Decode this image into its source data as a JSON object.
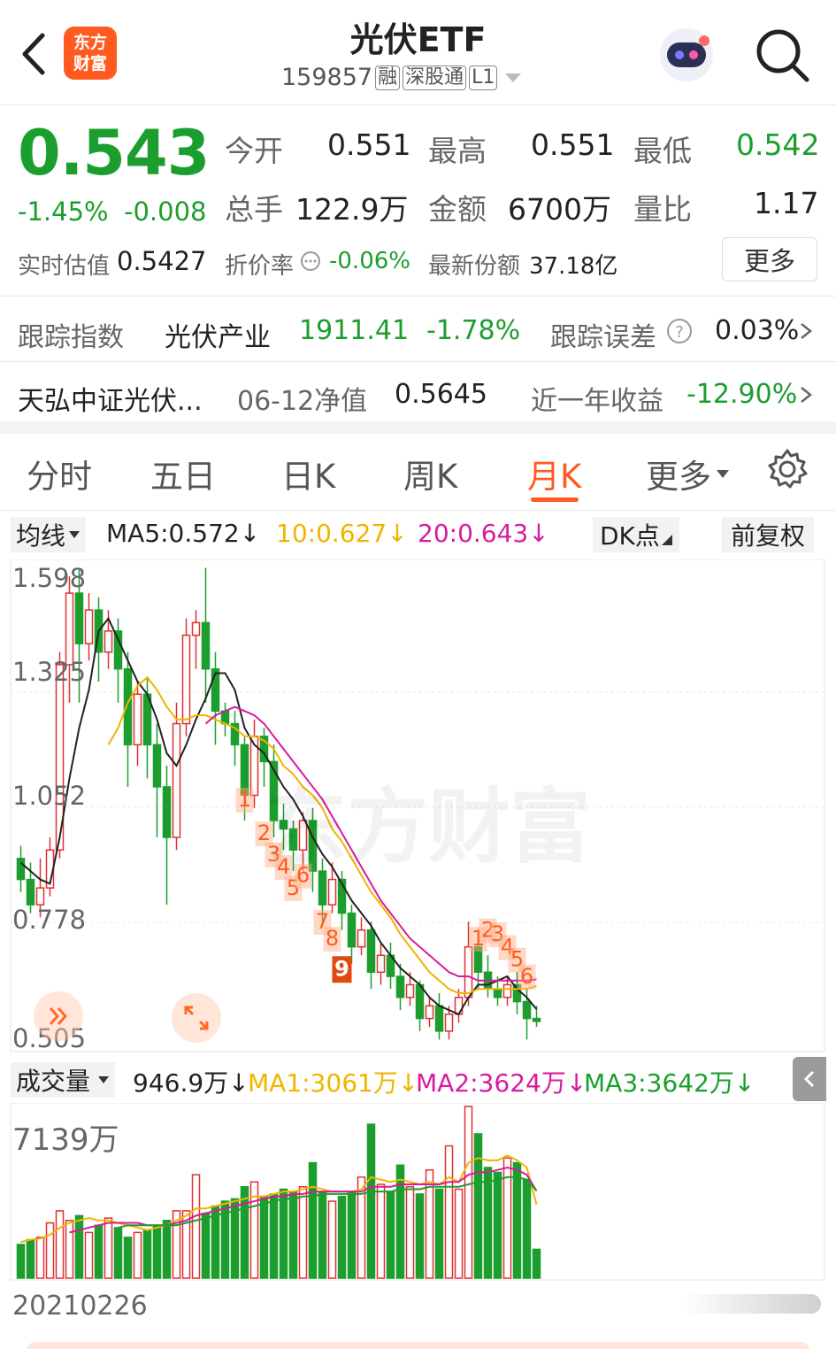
{
  "header": {
    "logo_top": "东方",
    "logo_bottom": "财富",
    "title": "光伏ETF",
    "code": "159857",
    "tags": [
      "融",
      "深股通",
      "L1"
    ]
  },
  "quote": {
    "price": "0.543",
    "change_pct": "-1.45%",
    "change": "-0.008",
    "open_label": "今开",
    "open": "0.551",
    "high_label": "最高",
    "high": "0.551",
    "low_label": "最低",
    "low": "0.542",
    "volume_label": "总手",
    "volume": "122.9万",
    "amount_label": "金额",
    "amount": "6700万",
    "ratio_label": "量比",
    "ratio": "1.17",
    "iopv_label": "实时估值",
    "iopv": "0.5427",
    "discount_label": "折价率",
    "discount": "-0.06%",
    "shares_label": "最新份额",
    "shares": "37.18亿",
    "more_label": "更多"
  },
  "tracking": {
    "index_label": "跟踪指数",
    "index_name": "光伏产业",
    "index_value": "1911.41",
    "index_change": "-1.78%",
    "error_label": "跟踪误差",
    "error_value": "0.03%"
  },
  "fund": {
    "name": "天弘中证光伏...",
    "nav_label": "06-12净值",
    "nav": "0.5645",
    "return_label": "近一年收益",
    "return_value": "-12.90%"
  },
  "tabs": [
    {
      "label": "分时",
      "active": false
    },
    {
      "label": "五日",
      "active": false
    },
    {
      "label": "日K",
      "active": false
    },
    {
      "label": "周K",
      "active": false
    },
    {
      "label": "月K",
      "active": true
    },
    {
      "label": "更多",
      "active": false
    }
  ],
  "ma_bar": {
    "selector": "均线",
    "ma5": "MA5:0.572",
    "ma10": "10:0.627",
    "ma20": "20:0.643",
    "dk_label": "DK点",
    "adjust_label": "前复权"
  },
  "price_axis": [
    "1.598",
    "1.325",
    "1.052",
    "0.778",
    "0.505"
  ],
  "watermark": "东方财富",
  "vol_bar": {
    "selector": "成交量",
    "vol": "946.9万",
    "ma1": "MA1:3061万",
    "ma2": "MA2:3624万",
    "ma3": "MA3:3642万"
  },
  "vol_axis_max": "7139万",
  "start_date": "20210226",
  "colors": {
    "up": "#e03030",
    "down": "#1c9e2e",
    "accent": "#ff5a1f",
    "ma5": "#222222",
    "ma10": "#f0b400",
    "ma20": "#d81b9e"
  },
  "chart_data": {
    "type": "candlestick",
    "ylim": [
      0.505,
      1.598
    ],
    "candles": [
      [
        0.93,
        0.88,
        0.96,
        0.85
      ],
      [
        0.88,
        0.82,
        0.92,
        0.8
      ],
      [
        0.82,
        0.86,
        0.93,
        0.79
      ],
      [
        0.86,
        0.95,
        0.98,
        0.84
      ],
      [
        0.95,
        1.39,
        1.42,
        0.93
      ],
      [
        1.39,
        1.56,
        1.6,
        1.3
      ],
      [
        1.56,
        1.44,
        1.62,
        1.3
      ],
      [
        1.44,
        1.52,
        1.56,
        1.4
      ],
      [
        1.52,
        1.42,
        1.55,
        1.35
      ],
      [
        1.42,
        1.47,
        1.52,
        1.38
      ],
      [
        1.47,
        1.38,
        1.5,
        1.3
      ],
      [
        1.38,
        1.2,
        1.42,
        1.1
      ],
      [
        1.2,
        1.32,
        1.35,
        1.15
      ],
      [
        1.32,
        1.2,
        1.36,
        1.12
      ],
      [
        1.2,
        1.1,
        1.25,
        0.98
      ],
      [
        1.1,
        0.98,
        1.15,
        0.82
      ],
      [
        0.98,
        1.25,
        1.3,
        0.95
      ],
      [
        1.25,
        1.46,
        1.5,
        1.22
      ],
      [
        1.46,
        1.49,
        1.52,
        1.38
      ],
      [
        1.49,
        1.38,
        1.62,
        1.3
      ],
      [
        1.38,
        1.28,
        1.42,
        1.2
      ],
      [
        1.28,
        1.25,
        1.3,
        1.22
      ],
      [
        1.25,
        1.2,
        1.28,
        1.15
      ],
      [
        1.2,
        1.08,
        1.22,
        1.02
      ],
      [
        1.08,
        1.22,
        1.26,
        1.05
      ],
      [
        1.22,
        1.16,
        1.24,
        1.1
      ],
      [
        1.16,
        1.02,
        1.2,
        0.98
      ],
      [
        1.02,
        1.0,
        1.06,
        0.95
      ],
      [
        1.0,
        0.95,
        1.02,
        0.9
      ],
      [
        0.95,
        1.02,
        1.04,
        0.9
      ],
      [
        1.02,
        0.9,
        1.05,
        0.85
      ],
      [
        0.9,
        0.82,
        0.93,
        0.78
      ],
      [
        0.82,
        0.88,
        0.92,
        0.8
      ],
      [
        0.88,
        0.8,
        0.9,
        0.76
      ],
      [
        0.8,
        0.72,
        0.82,
        0.68
      ],
      [
        0.72,
        0.76,
        0.79,
        0.7
      ],
      [
        0.76,
        0.66,
        0.78,
        0.62
      ],
      [
        0.66,
        0.7,
        0.73,
        0.63
      ],
      [
        0.7,
        0.65,
        0.73,
        0.62
      ],
      [
        0.65,
        0.6,
        0.68,
        0.57
      ],
      [
        0.6,
        0.63,
        0.66,
        0.58
      ],
      [
        0.63,
        0.55,
        0.64,
        0.52
      ],
      [
        0.55,
        0.58,
        0.6,
        0.53
      ],
      [
        0.58,
        0.52,
        0.61,
        0.5
      ],
      [
        0.52,
        0.56,
        0.58,
        0.5
      ],
      [
        0.56,
        0.6,
        0.62,
        0.54
      ],
      [
        0.6,
        0.72,
        0.78,
        0.58
      ],
      [
        0.72,
        0.66,
        0.76,
        0.62
      ],
      [
        0.66,
        0.62,
        0.7,
        0.6
      ],
      [
        0.62,
        0.6,
        0.65,
        0.58
      ],
      [
        0.6,
        0.63,
        0.65,
        0.58
      ],
      [
        0.63,
        0.59,
        0.66,
        0.56
      ],
      [
        0.59,
        0.55,
        0.62,
        0.5
      ],
      [
        0.55,
        0.543,
        0.58,
        0.53
      ]
    ],
    "ma5": [
      0.92,
      0.9,
      0.88,
      0.87,
      0.98,
      1.12,
      1.24,
      1.33,
      1.47,
      1.5,
      1.45,
      1.4,
      1.35,
      1.32,
      1.26,
      1.18,
      1.15,
      1.2,
      1.26,
      1.31,
      1.37,
      1.37,
      1.33,
      1.24,
      1.2,
      1.18,
      1.14,
      1.1,
      1.07,
      1.03,
      0.98,
      0.94,
      0.91,
      0.87,
      0.83,
      0.8,
      0.77,
      0.73,
      0.7,
      0.67,
      0.65,
      0.63,
      0.6,
      0.58,
      0.57,
      0.56,
      0.6,
      0.63,
      0.63,
      0.64,
      0.65,
      0.62,
      0.6,
      0.572
    ],
    "ma10": [
      null,
      null,
      null,
      null,
      null,
      null,
      null,
      null,
      null,
      1.2,
      1.24,
      1.3,
      1.34,
      1.36,
      1.33,
      1.29,
      1.26,
      1.26,
      1.27,
      1.27,
      1.26,
      1.25,
      1.24,
      1.22,
      1.22,
      1.21,
      1.19,
      1.15,
      1.13,
      1.1,
      1.08,
      1.05,
      1.0,
      0.97,
      0.93,
      0.89,
      0.85,
      0.82,
      0.79,
      0.75,
      0.72,
      0.69,
      0.66,
      0.64,
      0.62,
      0.61,
      0.61,
      0.62,
      0.62,
      0.62,
      0.62,
      0.62,
      0.62,
      0.627
    ],
    "ma20": [
      null,
      null,
      null,
      null,
      null,
      null,
      null,
      null,
      null,
      null,
      null,
      null,
      null,
      null,
      null,
      null,
      null,
      null,
      null,
      1.25,
      1.27,
      1.28,
      1.29,
      1.28,
      1.27,
      1.25,
      1.22,
      1.19,
      1.16,
      1.13,
      1.1,
      1.07,
      1.03,
      0.99,
      0.95,
      0.91,
      0.87,
      0.83,
      0.8,
      0.77,
      0.74,
      0.72,
      0.7,
      0.68,
      0.66,
      0.65,
      0.65,
      0.64,
      0.64,
      0.64,
      0.64,
      0.64,
      0.64,
      0.643
    ],
    "signals": [
      {
        "label": "1",
        "index": 23,
        "price": 1.06
      },
      {
        "label": "2",
        "index": 25,
        "price": 0.98
      },
      {
        "label": "3",
        "index": 26,
        "price": 0.93
      },
      {
        "label": "4",
        "index": 27,
        "price": 0.9
      },
      {
        "label": "5",
        "index": 28,
        "price": 0.85
      },
      {
        "label": "6",
        "index": 29,
        "price": 0.88
      },
      {
        "label": "7",
        "index": 31,
        "price": 0.77
      },
      {
        "label": "8",
        "index": 32,
        "price": 0.73
      },
      {
        "label": "9",
        "index": 33,
        "price": 0.66,
        "boxed": true
      },
      {
        "label": "1",
        "index": 47,
        "price": 0.73
      },
      {
        "label": "2",
        "index": 48,
        "price": 0.75
      },
      {
        "label": "3",
        "index": 49,
        "price": 0.74
      },
      {
        "label": "4",
        "index": 50,
        "price": 0.71
      },
      {
        "label": "5",
        "index": 51,
        "price": 0.68
      },
      {
        "label": "6",
        "index": 52,
        "price": 0.64
      }
    ],
    "volume": [
      1400,
      1600,
      1700,
      2300,
      2800,
      2400,
      2600,
      1900,
      2200,
      2500,
      2100,
      1700,
      1900,
      2000,
      2200,
      2400,
      2800,
      2800,
      4300,
      2700,
      3000,
      3200,
      3300,
      3800,
      4000,
      3400,
      3500,
      3700,
      3600,
      3800,
      4800,
      3600,
      3200,
      3400,
      3600,
      4200,
      6400,
      3900,
      3600,
      4700,
      3800,
      3500,
      4500,
      3700,
      5500,
      3700,
      7139,
      6000,
      4600,
      4400,
      5000,
      4800,
      4100,
      1200
    ],
    "vol_ma1": [
      1500,
      1600,
      1650,
      1800,
      2100,
      2300,
      2400,
      2500,
      2400,
      2400,
      2300,
      2200,
      2100,
      2000,
      2100,
      2200,
      2400,
      2600,
      2900,
      2900,
      3000,
      3100,
      3200,
      3300,
      3400,
      3400,
      3500,
      3600,
      3600,
      3700,
      3800,
      3700,
      3600,
      3600,
      3600,
      3700,
      4200,
      4100,
      4000,
      4100,
      4000,
      3900,
      4000,
      3900,
      4200,
      4000,
      4800,
      5000,
      4900,
      4900,
      5100,
      4900,
      4600,
      3061
    ],
    "vol_ma2": [
      null,
      null,
      null,
      null,
      null,
      1900,
      2000,
      2100,
      2200,
      2300,
      2300,
      2300,
      2300,
      2200,
      2200,
      2200,
      2300,
      2400,
      2600,
      2700,
      2800,
      2900,
      3000,
      3100,
      3200,
      3300,
      3400,
      3400,
      3500,
      3500,
      3600,
      3600,
      3600,
      3600,
      3600,
      3600,
      3800,
      3800,
      3800,
      3900,
      3900,
      3900,
      3900,
      3900,
      4000,
      4000,
      4300,
      4400,
      4400,
      4500,
      4600,
      4500,
      4300,
      3624
    ],
    "vol_ma3": [
      null,
      null,
      null,
      null,
      null,
      null,
      null,
      null,
      null,
      null,
      2100,
      2200,
      2200,
      2200,
      2200,
      2200,
      2200,
      2300,
      2400,
      2500,
      2600,
      2700,
      2800,
      2900,
      3000,
      3100,
      3200,
      3300,
      3300,
      3400,
      3400,
      3500,
      3500,
      3500,
      3500,
      3500,
      3600,
      3600,
      3600,
      3700,
      3700,
      3700,
      3800,
      3800,
      3800,
      3800,
      3900,
      4000,
      4000,
      4100,
      4200,
      4200,
      4100,
      3642
    ]
  }
}
